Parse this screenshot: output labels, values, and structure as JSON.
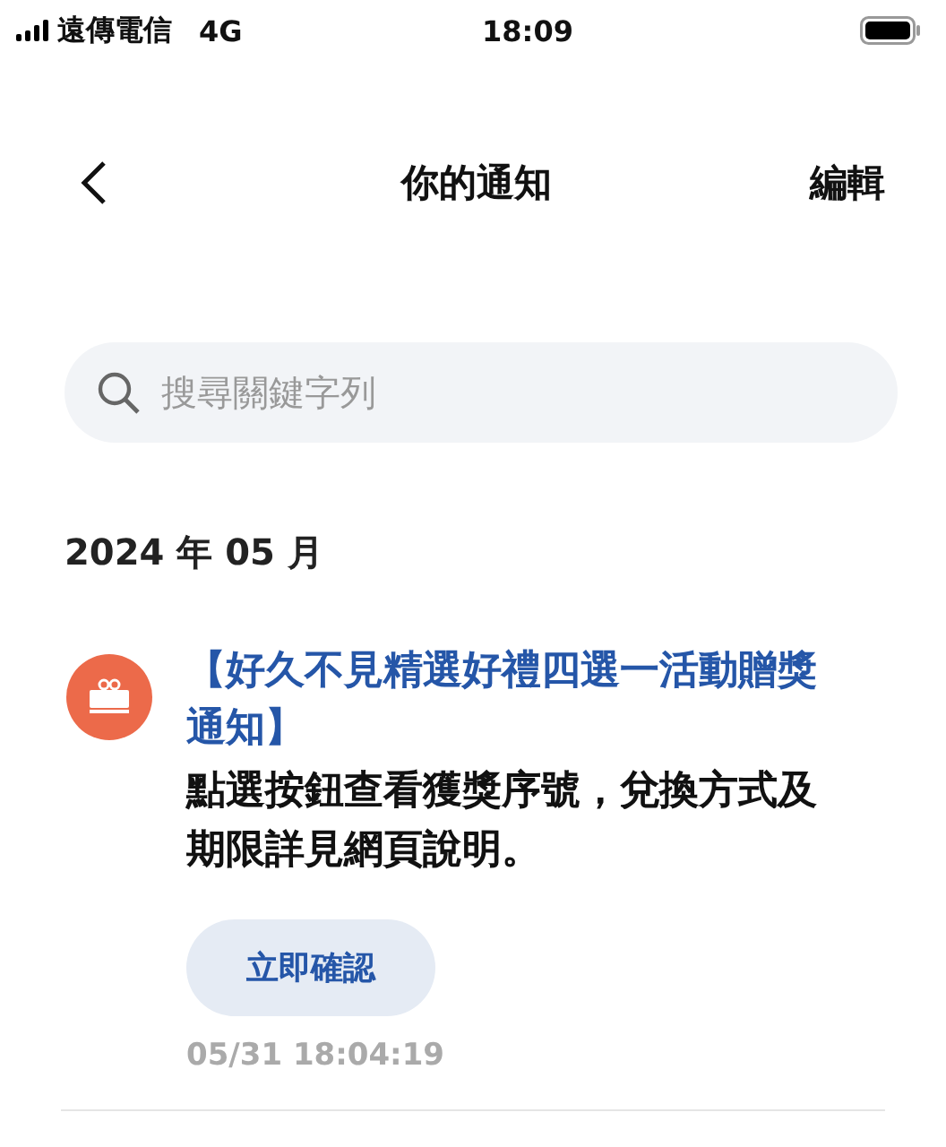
{
  "status_bar": {
    "carrier": "遠傳電信",
    "network": "4G",
    "time": "18:09"
  },
  "nav": {
    "title": "你的通知",
    "edit": "編輯"
  },
  "search": {
    "placeholder": "搜尋關鍵字列"
  },
  "sections": [
    {
      "heading": "2024 年 05 月",
      "notifications": [
        {
          "title": "【好久不見精選好禮四選一活動贈獎通知】",
          "body": "點選按鈕查看獲獎序號，兌換方式及期限詳見網頁說明。",
          "action": "立即確認",
          "time": "05/31 18:04:19"
        }
      ]
    }
  ]
}
